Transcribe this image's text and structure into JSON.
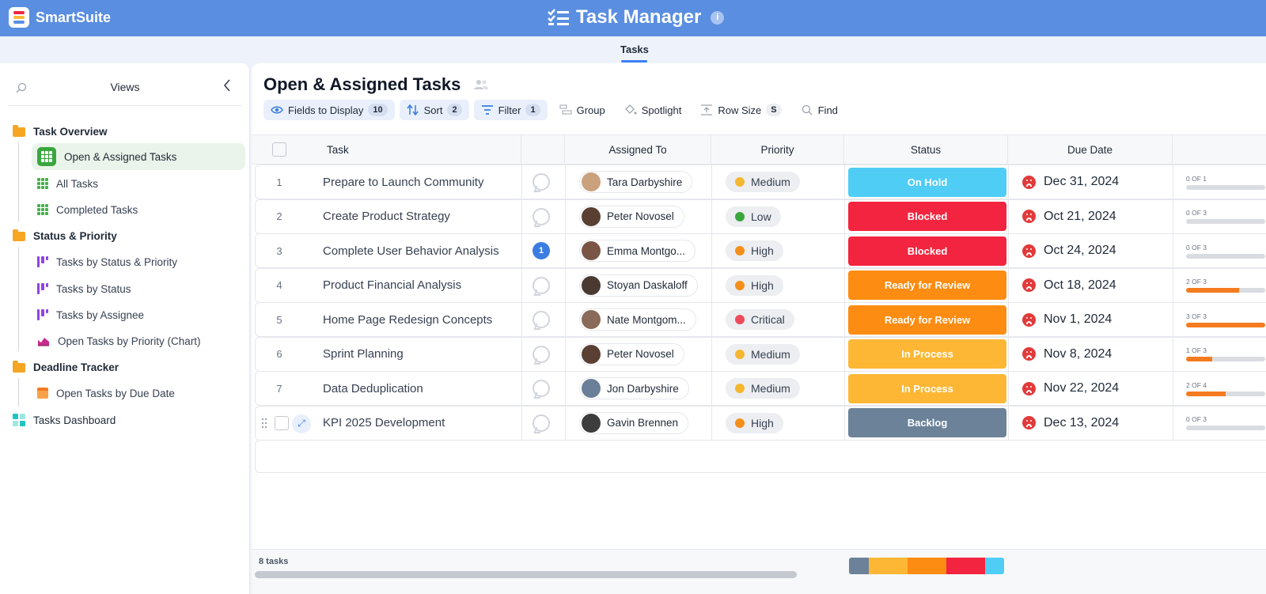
{
  "brand": {
    "name": "SmartSuite"
  },
  "app": {
    "title": "Task Manager"
  },
  "tabs": {
    "active": "Tasks"
  },
  "sidebar": {
    "header": "Views",
    "groups": [
      {
        "label": "Task Overview",
        "items": [
          {
            "label": "Open & Assigned Tasks",
            "icon": "grid-icon",
            "active": true
          },
          {
            "label": "All Tasks",
            "icon": "grid-icon"
          },
          {
            "label": "Completed Tasks",
            "icon": "grid-icon"
          }
        ]
      },
      {
        "label": "Status & Priority",
        "items": [
          {
            "label": "Tasks by Status & Priority",
            "icon": "kanban-icon"
          },
          {
            "label": "Tasks by Status",
            "icon": "kanban-icon"
          },
          {
            "label": "Tasks by Assignee",
            "icon": "kanban-icon"
          },
          {
            "label": "Open Tasks by Priority (Chart)",
            "icon": "chart-icon"
          }
        ]
      },
      {
        "label": "Deadline Tracker",
        "items": [
          {
            "label": "Open Tasks by Due Date",
            "icon": "calendar-icon"
          }
        ]
      }
    ],
    "dashboard": "Tasks Dashboard"
  },
  "view": {
    "title": "Open & Assigned Tasks",
    "toolbar": {
      "fields": {
        "label": "Fields to Display",
        "count": "10"
      },
      "sort": {
        "label": "Sort",
        "count": "2"
      },
      "filter": {
        "label": "Filter",
        "count": "1"
      },
      "group": "Group",
      "spotlight": "Spotlight",
      "rowsize": {
        "label": "Row Size",
        "value": "S"
      },
      "find": "Find"
    }
  },
  "columns": {
    "task": "Task",
    "assigned": "Assigned To",
    "priority": "Priority",
    "status": "Status",
    "due": "Due Date"
  },
  "rows": [
    {
      "num": "1",
      "task": "Prepare to Launch Community",
      "comments": "",
      "assignee": "Tara Darbyshire",
      "priority": "Medium",
      "status": "On Hold",
      "due": "Dec 31, 2024",
      "progress": "0 OF 1",
      "pct": 0
    },
    {
      "num": "2",
      "task": "Create Product Strategy",
      "comments": "",
      "assignee": "Peter Novosel",
      "priority": "Low",
      "status": "Blocked",
      "due": "Oct 21, 2024",
      "progress": "0 OF 3",
      "pct": 0
    },
    {
      "num": "3",
      "task": "Complete User Behavior Analysis",
      "comments": "1",
      "assignee": "Emma Montgo...",
      "priority": "High",
      "status": "Blocked",
      "due": "Oct 24, 2024",
      "progress": "0 OF 3",
      "pct": 0
    },
    {
      "num": "4",
      "task": "Product Financial Analysis",
      "comments": "",
      "assignee": "Stoyan Daskaloff",
      "priority": "High",
      "status": "Ready for Review",
      "due": "Oct 18, 2024",
      "progress": "2 OF 3",
      "pct": 0.67
    },
    {
      "num": "5",
      "task": "Home Page Redesign Concepts",
      "comments": "",
      "assignee": "Nate Montgom...",
      "priority": "Critical",
      "status": "Ready for Review",
      "due": "Nov 1, 2024",
      "progress": "3 OF 3",
      "pct": 1
    },
    {
      "num": "6",
      "task": "Sprint Planning",
      "comments": "",
      "assignee": "Peter Novosel",
      "priority": "Medium",
      "status": "In Process",
      "due": "Nov 8, 2024",
      "progress": "1 OF 3",
      "pct": 0.33
    },
    {
      "num": "7",
      "task": "Data Deduplication",
      "comments": "",
      "assignee": "Jon Darbyshire",
      "priority": "Medium",
      "status": "In Process",
      "due": "Nov 22, 2024",
      "progress": "2 OF 4",
      "pct": 0.5
    },
    {
      "num": "",
      "task": "KPI 2025 Development",
      "comments": "",
      "assignee": "Gavin Brennen",
      "priority": "High",
      "status": "Backlog",
      "due": "Dec 13, 2024",
      "progress": "0 OF 3",
      "pct": 0
    }
  ],
  "priorityColors": {
    "Medium": "#f5b731",
    "Low": "#3aa63e",
    "High": "#f58f1b",
    "Critical": "#ef4b5a"
  },
  "statusColors": {
    "On Hold": "#4fcdf5",
    "Blocked": "#f2243f",
    "Ready for Review": "#fd8c12",
    "In Process": "#fdb735",
    "Backlog": "#6b8299"
  },
  "avatarColors": [
    "#c9a27d",
    "#5a4033",
    "#7a5546",
    "#4a3a32",
    "#8a6a58",
    "#5a4033",
    "#6b7f99",
    "#3d3d3d"
  ],
  "footer": {
    "count": "8 tasks"
  },
  "summary": [
    {
      "status": "Backlog",
      "share": 0.125
    },
    {
      "status": "In Process",
      "share": 0.25
    },
    {
      "status": "Ready for Review",
      "share": 0.25
    },
    {
      "status": "Blocked",
      "share": 0.25
    },
    {
      "status": "On Hold",
      "share": 0.125
    }
  ]
}
